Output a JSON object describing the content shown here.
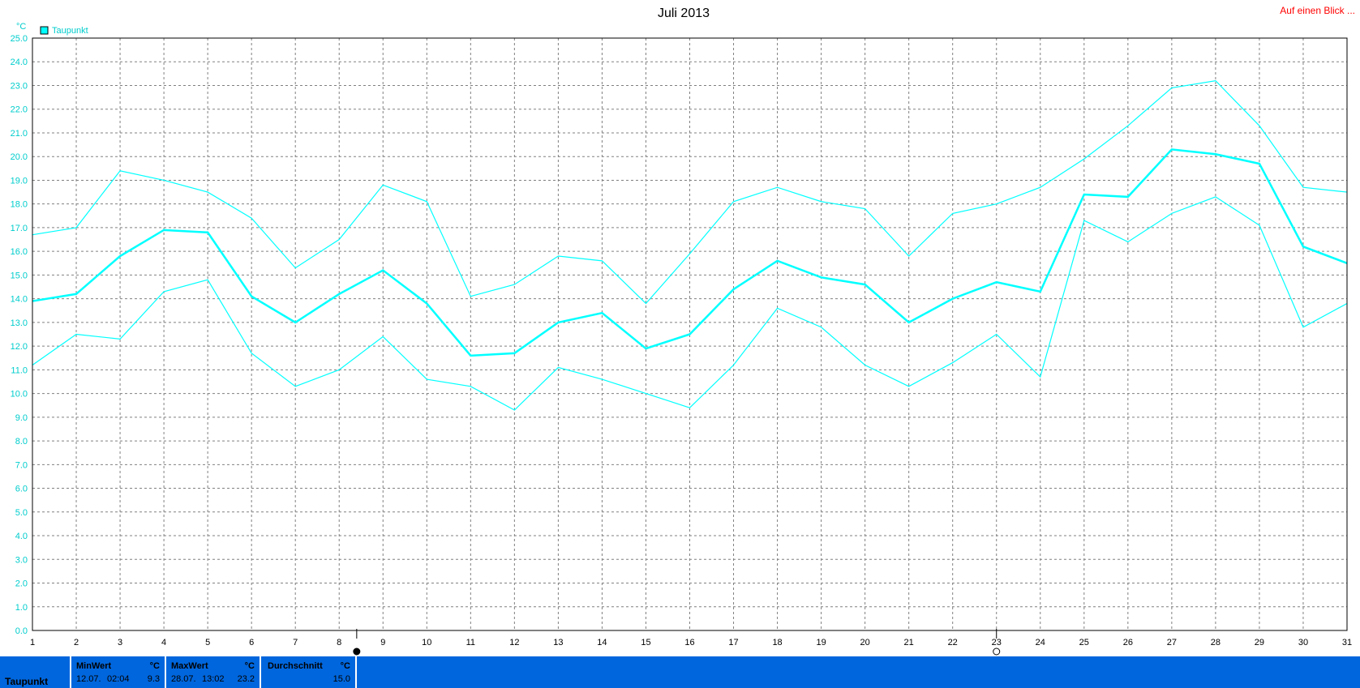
{
  "chart_data": {
    "type": "line",
    "title": "Juli 2013",
    "ylabel": "°C",
    "ylim": [
      0,
      25
    ],
    "ytick_step": 1,
    "grid": true,
    "legend_position": "top-left",
    "legend": [
      {
        "name": "Taupunkt",
        "color": "#00ffff"
      }
    ],
    "x": [
      1,
      2,
      3,
      4,
      5,
      6,
      7,
      8,
      9,
      10,
      11,
      12,
      13,
      14,
      15,
      16,
      17,
      18,
      19,
      20,
      21,
      22,
      23,
      24,
      25,
      26,
      27,
      28,
      29,
      30,
      31
    ],
    "series": [
      {
        "name": "Taupunkt",
        "role": "max",
        "color": "#00ffff",
        "values": [
          16.7,
          17.0,
          19.4,
          19.0,
          18.5,
          17.4,
          15.3,
          16.5,
          18.8,
          18.1,
          14.1,
          14.6,
          15.8,
          15.6,
          13.8,
          15.9,
          18.1,
          18.7,
          18.1,
          17.8,
          15.8,
          17.6,
          18.0,
          18.7,
          19.9,
          21.3,
          22.9,
          23.2,
          21.3,
          18.7,
          18.5
        ]
      },
      {
        "name": "Taupunkt",
        "role": "avg",
        "color": "#00ffff",
        "values": [
          13.9,
          14.2,
          15.8,
          16.9,
          16.8,
          14.1,
          13.0,
          14.2,
          15.2,
          13.8,
          11.6,
          11.7,
          13.0,
          13.4,
          11.9,
          12.5,
          14.4,
          15.6,
          14.9,
          14.6,
          13.0,
          14.0,
          14.7,
          14.3,
          18.4,
          18.3,
          20.3,
          20.1,
          19.7,
          16.2,
          15.5
        ]
      },
      {
        "name": "Taupunkt",
        "role": "min",
        "color": "#00ffff",
        "values": [
          11.2,
          12.5,
          12.3,
          14.3,
          14.8,
          11.7,
          10.3,
          11.0,
          12.4,
          10.6,
          10.3,
          9.3,
          11.1,
          10.6,
          10.0,
          9.4,
          11.2,
          13.6,
          12.8,
          11.2,
          10.3,
          11.3,
          12.5,
          10.7,
          17.3,
          16.4,
          17.6,
          18.3,
          17.1,
          12.8,
          13.8
        ]
      }
    ],
    "markers": [
      {
        "x": 8.4,
        "icon": "full-moon-icon"
      },
      {
        "x": 23.0,
        "icon": "new-moon-icon"
      }
    ]
  },
  "corner_link": "Auf einen Blick ...",
  "stats": {
    "series_name": "Taupunkt",
    "min": {
      "label": "MinWert",
      "unit": "°C",
      "date": "12.07.",
      "time": "02:04",
      "value": "9.3"
    },
    "max": {
      "label": "MaxWert",
      "unit": "°C",
      "date": "28.07.",
      "time": "13:02",
      "value": "23.2"
    },
    "avg": {
      "label": "Durchschnitt",
      "unit": "°C",
      "value": "15.0"
    }
  }
}
